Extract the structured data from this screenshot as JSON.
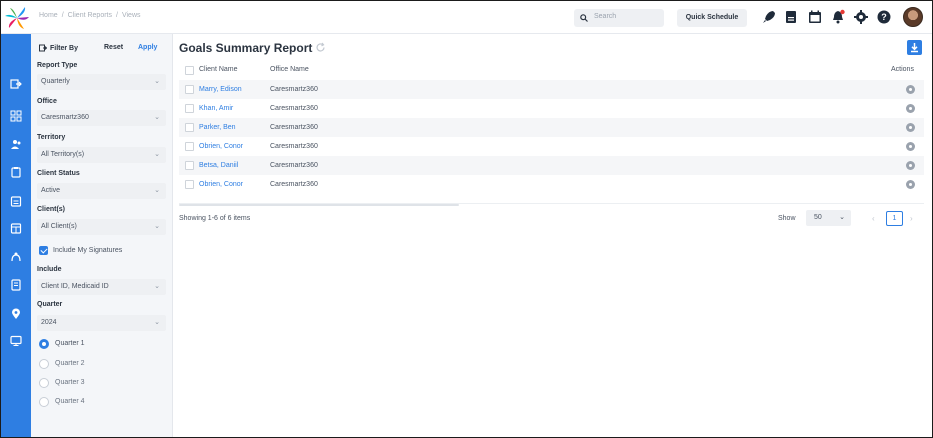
{
  "breadcrumb": [
    "Home",
    "/",
    "Client Reports",
    "/",
    "Views"
  ],
  "search": {
    "placeholder": "Search"
  },
  "header": {
    "quick_schedule": "Quick Schedule"
  },
  "header_icons": [
    "rocket-icon",
    "document-icon",
    "calendar-icon",
    "notification-bell-icon",
    "settings-gear-icon",
    "help-icon"
  ],
  "rail_icons": [
    "dashboard-exit-icon",
    "grid-icon",
    "users-icon",
    "clipboard-icon",
    "calendar-list-icon",
    "schedule-icon",
    "route-icon",
    "report-icon",
    "location-icon",
    "monitor-icon"
  ],
  "filter": {
    "title": "Filter By",
    "reset": "Reset",
    "apply": "Apply",
    "report_type_label": "Report Type",
    "report_type_value": "Quarterly",
    "office_label": "Office",
    "office_value": "Caresmartz360",
    "territory_label": "Territory",
    "territory_value": "All Territory(s)",
    "client_status_label": "Client Status",
    "client_status_value": "Active",
    "clients_label": "Client(s)",
    "clients_value": "All Client(s)",
    "include_signatures": "Include My Signatures",
    "include_label": "Include",
    "include_value": "Client ID, Medicaid ID",
    "quarter_label": "Quarter",
    "quarter_value": "2024",
    "quarters": [
      "Quarter 1",
      "Quarter 2",
      "Quarter 3",
      "Quarter 4"
    ],
    "selected_quarter": "Quarter 1"
  },
  "main": {
    "title": "Goals Summary Report",
    "columns": {
      "client_name": "Client Name",
      "office_name": "Office Name",
      "actions": "Actions"
    },
    "rows": [
      {
        "client": "Marry, Edison",
        "office": "Caresmartz360"
      },
      {
        "client": "Khan, Amir",
        "office": "Caresmartz360"
      },
      {
        "client": "Parker, Ben",
        "office": "Caresmartz360"
      },
      {
        "client": "Obrien, Conor",
        "office": "Caresmartz360"
      },
      {
        "client": "Betsa, Daniil",
        "office": "Caresmartz360"
      },
      {
        "client": "Obrien, Conor",
        "office": "Caresmartz360"
      }
    ],
    "showing": "Showing 1-6 of 6 items",
    "show_label": "Show",
    "per_page": "50",
    "page": "1"
  },
  "colors": {
    "accent": "#2e7ee2",
    "rail": "#2e7ee2"
  }
}
